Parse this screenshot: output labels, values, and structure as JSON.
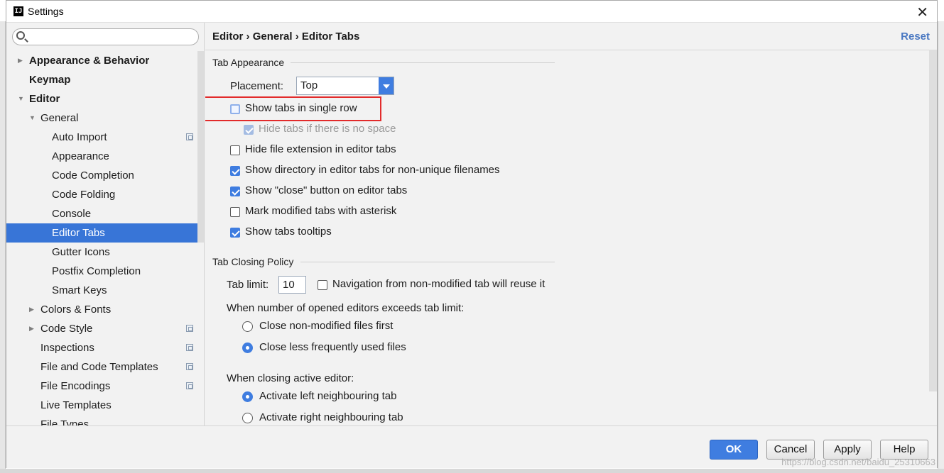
{
  "window": {
    "title": "Settings",
    "app_icon_text": "IJ"
  },
  "search": {
    "placeholder": ""
  },
  "tree": [
    {
      "label": "Appearance & Behavior",
      "level": 0,
      "arrow": "▶",
      "bold": true,
      "icon": false,
      "selected": false
    },
    {
      "label": "Keymap",
      "level": 0,
      "arrow": "",
      "bold": true,
      "icon": false,
      "selected": false
    },
    {
      "label": "Editor",
      "level": 0,
      "arrow": "▼",
      "bold": true,
      "icon": false,
      "selected": false
    },
    {
      "label": "General",
      "level": 1,
      "arrow": "▼",
      "bold": false,
      "icon": false,
      "selected": false
    },
    {
      "label": "Auto Import",
      "level": 2,
      "arrow": "",
      "bold": false,
      "icon": true,
      "selected": false
    },
    {
      "label": "Appearance",
      "level": 2,
      "arrow": "",
      "bold": false,
      "icon": false,
      "selected": false
    },
    {
      "label": "Code Completion",
      "level": 2,
      "arrow": "",
      "bold": false,
      "icon": false,
      "selected": false
    },
    {
      "label": "Code Folding",
      "level": 2,
      "arrow": "",
      "bold": false,
      "icon": false,
      "selected": false
    },
    {
      "label": "Console",
      "level": 2,
      "arrow": "",
      "bold": false,
      "icon": false,
      "selected": false
    },
    {
      "label": "Editor Tabs",
      "level": 2,
      "arrow": "",
      "bold": false,
      "icon": false,
      "selected": true
    },
    {
      "label": "Gutter Icons",
      "level": 2,
      "arrow": "",
      "bold": false,
      "icon": false,
      "selected": false
    },
    {
      "label": "Postfix Completion",
      "level": 2,
      "arrow": "",
      "bold": false,
      "icon": false,
      "selected": false
    },
    {
      "label": "Smart Keys",
      "level": 2,
      "arrow": "",
      "bold": false,
      "icon": false,
      "selected": false
    },
    {
      "label": "Colors & Fonts",
      "level": 1,
      "arrow": "▶",
      "bold": false,
      "icon": false,
      "selected": false
    },
    {
      "label": "Code Style",
      "level": 1,
      "arrow": "▶",
      "bold": false,
      "icon": true,
      "selected": false
    },
    {
      "label": "Inspections",
      "level": 1,
      "arrow": "",
      "bold": false,
      "icon": true,
      "selected": false
    },
    {
      "label": "File and Code Templates",
      "level": 1,
      "arrow": "",
      "bold": false,
      "icon": true,
      "selected": false
    },
    {
      "label": "File Encodings",
      "level": 1,
      "arrow": "",
      "bold": false,
      "icon": true,
      "selected": false
    },
    {
      "label": "Live Templates",
      "level": 1,
      "arrow": "",
      "bold": false,
      "icon": false,
      "selected": false
    },
    {
      "label": "File Types",
      "level": 1,
      "arrow": "",
      "bold": false,
      "icon": false,
      "selected": false
    }
  ],
  "header": {
    "crumb1": "Editor",
    "sep1": "›",
    "crumb2": "General",
    "sep2": "›",
    "crumb3": "Editor Tabs",
    "reset": "Reset"
  },
  "tab_appearance": {
    "title": "Tab Appearance",
    "placement_label": "Placement:",
    "placement_value": "Top",
    "options": [
      {
        "label": "Show tabs in single row",
        "checked": false,
        "disabled": false,
        "focused": true
      },
      {
        "label": "Hide tabs if there is no space",
        "checked": true,
        "disabled": true,
        "focused": false
      },
      {
        "label": "Hide file extension in editor tabs",
        "checked": false,
        "disabled": false,
        "focused": false
      },
      {
        "label": "Show directory in editor tabs for non-unique filenames",
        "checked": true,
        "disabled": false,
        "focused": false
      },
      {
        "label": "Show \"close\" button on editor tabs",
        "checked": true,
        "disabled": false,
        "focused": false
      },
      {
        "label": "Mark modified tabs with asterisk",
        "checked": false,
        "disabled": false,
        "focused": false
      },
      {
        "label": "Show tabs tooltips",
        "checked": true,
        "disabled": false,
        "focused": false
      }
    ]
  },
  "tab_closing": {
    "title": "Tab Closing Policy",
    "tab_limit_label": "Tab limit:",
    "tab_limit_value": "10",
    "reuse_label": "Navigation from non-modified tab will reuse it",
    "reuse_checked": false,
    "exceeds_label": "When number of opened editors exceeds tab limit:",
    "exceeds_options": [
      {
        "label": "Close non-modified files first",
        "selected": false
      },
      {
        "label": "Close less frequently used files",
        "selected": true
      }
    ],
    "active_label": "When closing active editor:",
    "active_options": [
      {
        "label": "Activate left neighbouring tab",
        "selected": true
      },
      {
        "label": "Activate right neighbouring tab",
        "selected": false
      }
    ]
  },
  "buttons": {
    "ok": "OK",
    "cancel": "Cancel",
    "apply": "Apply",
    "help": "Help"
  },
  "watermark": "https://blog.csdn.net/baidu_25310663",
  "colors": {
    "accent": "#3f7de0",
    "selection": "#3875d7",
    "highlight_box": "#e22b2b"
  }
}
